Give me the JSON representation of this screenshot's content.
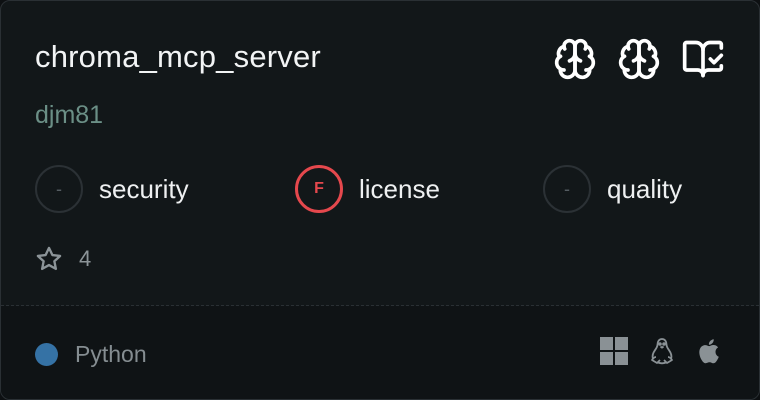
{
  "card": {
    "title": "chroma_mcp_server",
    "author": "djm81",
    "header_icons": [
      "brain-icon",
      "brain-icon",
      "book-check-icon"
    ],
    "scores": [
      {
        "label": "security",
        "grade": "-",
        "status": "none"
      },
      {
        "label": "license",
        "grade": "F",
        "status": "fail"
      },
      {
        "label": "quality",
        "grade": "-",
        "status": "none"
      }
    ],
    "stars": "4",
    "language": {
      "name": "Python",
      "color": "#3572A5"
    },
    "platforms": [
      "windows-icon",
      "linux-icon",
      "apple-icon"
    ],
    "colors": {
      "fail": "#e5484d",
      "author": "#6b8f86"
    }
  }
}
